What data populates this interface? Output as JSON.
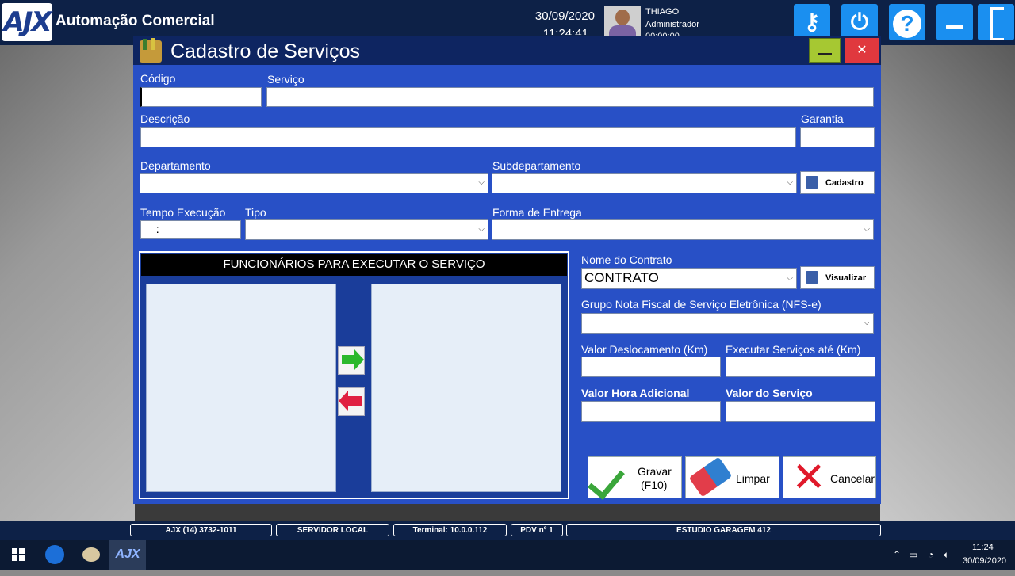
{
  "app": {
    "logo_text": "AJX",
    "title": "Automação Comercial",
    "date": "30/09/2020",
    "time": "11:24:41",
    "user_name": "THIAGO",
    "user_role": "Administrador",
    "user_extra": "00:00:00"
  },
  "top_icons": [
    "key-icon",
    "connection-icon",
    "help-icon",
    "minimize-icon",
    "exit-door-icon"
  ],
  "dialog": {
    "title": "Cadastro de Serviços",
    "close_label": "✕",
    "fields": {
      "codigo_label": "Código",
      "codigo_value": "",
      "servico_label": "Serviço",
      "servico_value": "",
      "descricao_label": "Descrição",
      "descricao_value": "",
      "garantia_label": "Garantia",
      "garantia_value": "",
      "departamento_label": "Departamento",
      "departamento_value": "",
      "subdepartamento_label": "Subdepartamento",
      "subdepartamento_value": "",
      "cadastro_button": "Cadastro",
      "tempo_label": "Tempo Execução",
      "tempo_value": "__:__",
      "tipo_label": "Tipo",
      "tipo_value": "",
      "forma_entrega_label": "Forma de Entrega",
      "forma_entrega_value": "",
      "nome_contrato_label": "Nome do Contrato",
      "nome_contrato_value": "CONTRATO",
      "visualizar_button": "Visualizar",
      "grupo_nfse_label": "Grupo Nota Fiscal de Serviço Eletrônica (NFS-e)",
      "grupo_nfse_value": "",
      "valor_deslocamento_label": "Valor Deslocamento (Km)",
      "valor_deslocamento_value": "",
      "executar_ate_label": "Executar Serviços até (Km)",
      "executar_ate_value": "",
      "valor_hora_label": "Valor Hora Adicional",
      "valor_hora_value": "",
      "valor_servico_label": "Valor do Serviço",
      "valor_servico_value": ""
    },
    "funcionarios": {
      "header": "FUNCIONÁRIOS PARA EXECUTAR O SERVIÇO",
      "available": [],
      "selected": []
    },
    "actions": {
      "gravar_line1": "Gravar",
      "gravar_line2": "(F10)",
      "limpar": "Limpar",
      "cancelar": "Cancelar"
    }
  },
  "statusbar": {
    "phone": "AJX (14) 3732-1011",
    "server": "SERVIDOR LOCAL",
    "terminal": "Terminal: 10.0.0.112",
    "pdv": "PDV nº 1",
    "company": "ESTUDIO GARAGEM 412"
  },
  "taskbar": {
    "clock_time": "11:24",
    "clock_date": "30/09/2020",
    "tray_icons": [
      "chevron-up-icon",
      "battery-icon",
      "wifi-icon",
      "volume-icon"
    ]
  },
  "colors": {
    "dialog_bg": "#2850c6",
    "titlebar": "#0e2561",
    "topbar": "#0d2147",
    "accent_icon": "#1a8ff0",
    "close_red": "#e0383e",
    "minimize_green": "#a6c832"
  }
}
